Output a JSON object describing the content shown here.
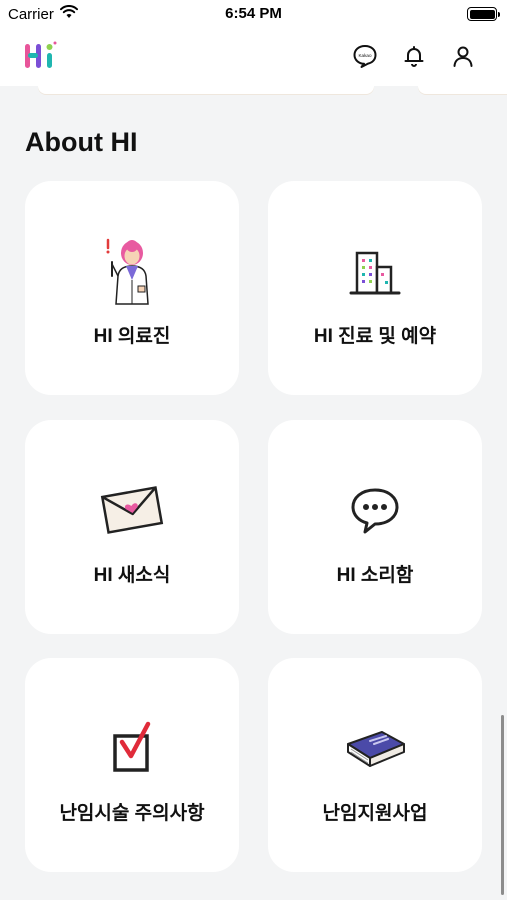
{
  "status_bar": {
    "carrier": "Carrier",
    "time": "6:54 PM",
    "battery_level": 1.0
  },
  "header": {
    "logo_text": "Hi",
    "icons": [
      "kakao-chat-icon",
      "bell-icon",
      "user-icon"
    ],
    "kakao_icon_text": "Kakao"
  },
  "section": {
    "title": "About HI"
  },
  "cards": [
    {
      "label": "HI 의료진",
      "icon": "doctor-illustration"
    },
    {
      "label": "HI 진료 및 예약",
      "icon": "building-illustration"
    },
    {
      "label": "HI 새소식",
      "icon": "envelope-illustration"
    },
    {
      "label": "HI 소리함",
      "icon": "speech-bubble-illustration"
    },
    {
      "label": "난임시술 주의사항",
      "icon": "checkbox-illustration"
    },
    {
      "label": "난임지원사업",
      "icon": "book-illustration"
    }
  ],
  "colors": {
    "background": "#f3f4f5",
    "card": "#ffffff",
    "text": "#111111",
    "logo_pink": "#e8559a",
    "logo_purple": "#7b4fd6",
    "logo_teal": "#1fb6b0",
    "logo_green": "#8fd14f"
  }
}
